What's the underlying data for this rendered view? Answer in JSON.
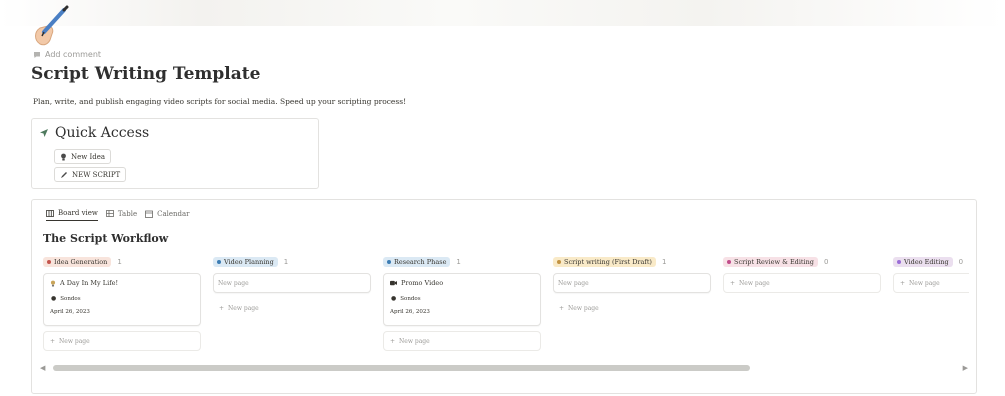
{
  "page": {
    "icon": "pen-in-hand-icon",
    "add_comment": "Add comment",
    "title": "Script Writing Template",
    "description": "Plan, write, and publish engaging video scripts for social media. Speed up your scripting process!"
  },
  "quick_access": {
    "title": "Quick Access",
    "icon": "arrow-pointer-icon",
    "buttons": [
      {
        "label": "New Idea",
        "icon": "lightbulb-icon"
      },
      {
        "label": "NEW SCRIPT",
        "icon": "pencil-icon"
      }
    ]
  },
  "board": {
    "tabs": [
      {
        "label": "Board view",
        "icon": "board-icon",
        "active": true
      },
      {
        "label": "Table",
        "icon": "table-icon",
        "active": false
      },
      {
        "label": "Calendar",
        "icon": "calendar-icon",
        "active": false
      }
    ],
    "title": "The Script Workflow",
    "new_page": "New page",
    "columns": [
      {
        "label": "Idea Generation",
        "count": "1",
        "bg": "#f8e4dc",
        "dot": "#c4554d",
        "card": {
          "name": "A Day In My Life!",
          "owner": "Sondos",
          "date": "April 26, 2023",
          "icon": "lightbulb-icon"
        }
      },
      {
        "label": "Video Planning",
        "count": "1",
        "bg": "#dbe9f4",
        "dot": "#3d7db3",
        "card": {
          "placeholder": "New page"
        }
      },
      {
        "label": "Research Phase",
        "count": "1",
        "bg": "#dbe9f4",
        "dot": "#3d7db3",
        "card": {
          "name": "Promo Video",
          "owner": "Sondos",
          "date": "April 26, 2023",
          "icon": "video-camera-icon"
        }
      },
      {
        "label": "Script writing (First Draft)",
        "count": "1",
        "bg": "#f9eac8",
        "dot": "#c29343",
        "card": {
          "placeholder": "New page"
        }
      },
      {
        "label": "Script Review & Editing",
        "count": "0",
        "bg": "#f7e1e6",
        "dot": "#c14c8a"
      },
      {
        "label": "Video Editing",
        "count": "0",
        "bg": "#ebdfef",
        "dot": "#9a6dd7"
      }
    ]
  },
  "colors": {
    "border": "#e3e2e0",
    "text": "#37352f",
    "muted": "#9b9a97"
  }
}
